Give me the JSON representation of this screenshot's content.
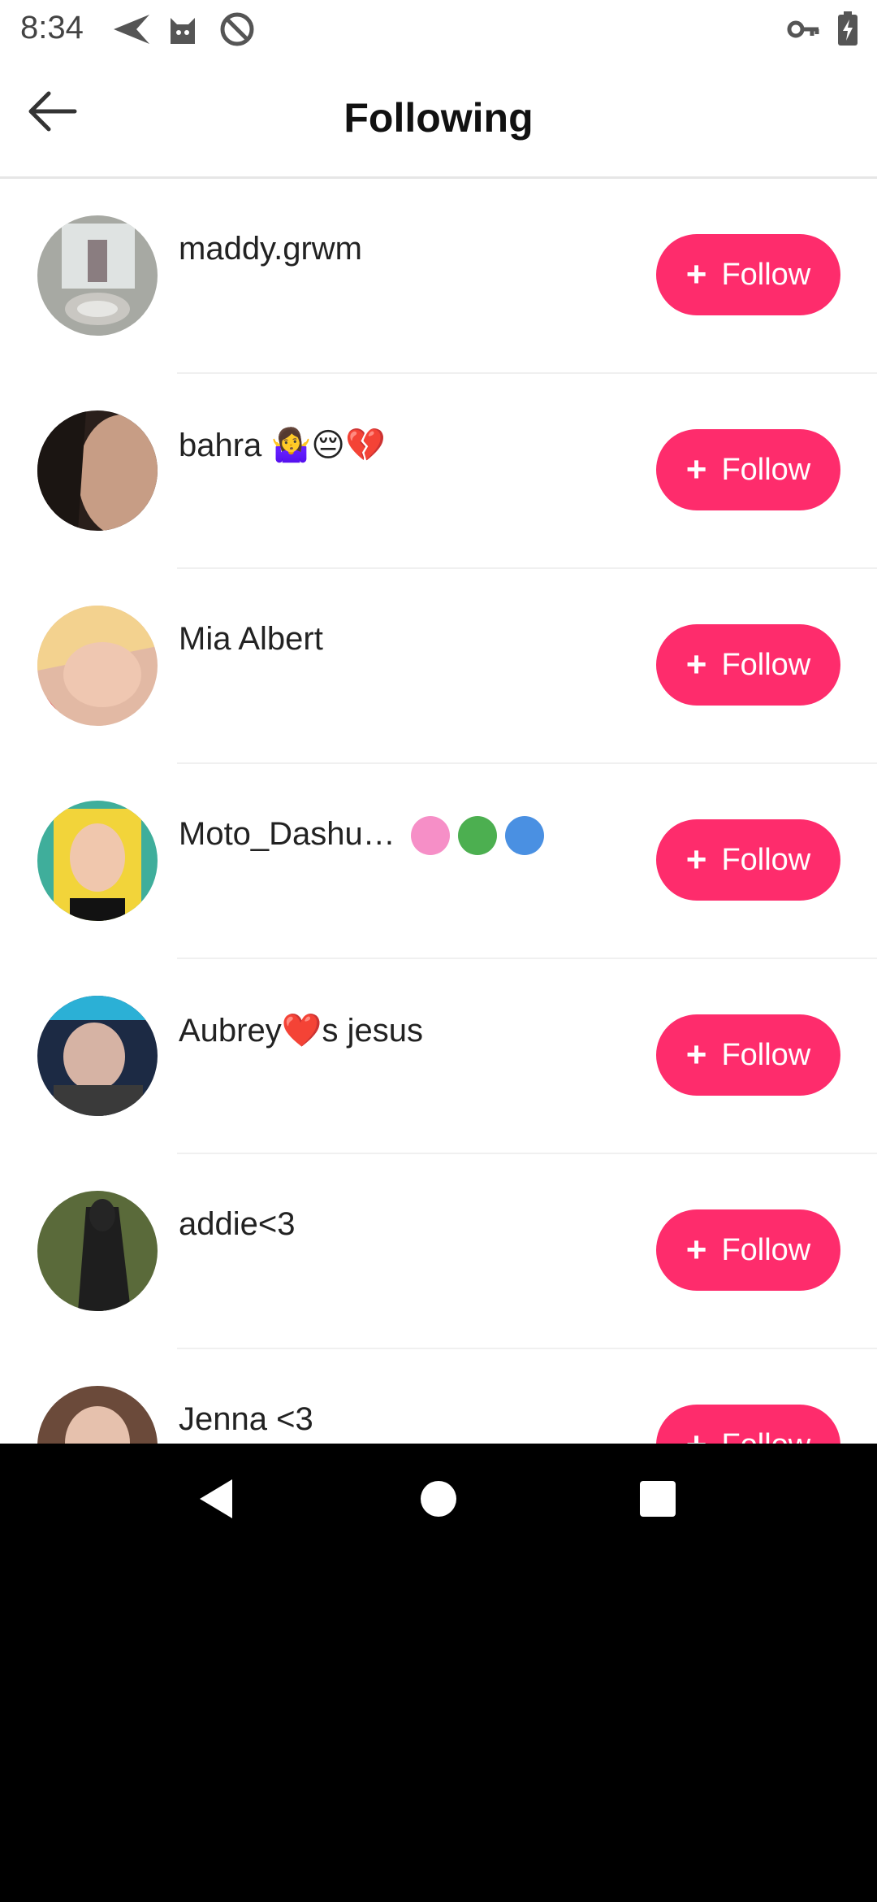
{
  "status_bar": {
    "time": "8:34",
    "icons_left": [
      "send-icon",
      "cat-icon",
      "no-disturb-icon"
    ],
    "icons_right": [
      "key-icon",
      "battery-charging-icon"
    ]
  },
  "header": {
    "title": "Following",
    "back_icon": "arrow-left-icon"
  },
  "accent_color": "#fe2c6c",
  "follow_label": "Follow",
  "users": [
    {
      "name": "maddy.grwm",
      "emoji": "",
      "badges": []
    },
    {
      "name": "bahra",
      "emoji": "🤷‍♀️😔💔",
      "badges": []
    },
    {
      "name": "Mia Albert",
      "emoji": "",
      "badges": []
    },
    {
      "name": "Moto_Dashu…",
      "emoji": "",
      "badges": [
        "diamond-badge-icon",
        "crown-badge-icon",
        "rank-badge-icon"
      ]
    },
    {
      "name": "Aubrey❤️s jesus",
      "emoji": "",
      "badges": []
    },
    {
      "name": "addie<3",
      "emoji": "",
      "badges": []
    },
    {
      "name": "Jenna <3",
      "emoji": "",
      "badges": []
    }
  ],
  "nav_bar": {
    "back": "nav-back-icon",
    "home": "nav-home-icon",
    "recents": "nav-recents-icon"
  }
}
